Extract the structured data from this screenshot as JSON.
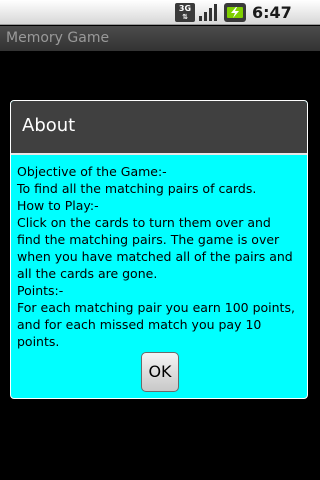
{
  "status_bar": {
    "network_label": "3G",
    "time": "6:47 PM"
  },
  "app": {
    "title": "Memory Game"
  },
  "dialog": {
    "title": "About",
    "lines": [
      "Objective of the Game:-",
      "To find all the matching pairs of cards.",
      "How to Play:-",
      "Click on the cards to turn them over and",
      "find the matching pairs. The game is over",
      "when you have matched all of the pairs and",
      "all the cards are gone.",
      "Points:-",
      "For each matching pair you earn 100 points,",
      "and for each missed match you pay 10",
      "points."
    ],
    "ok_label": "OK",
    "body_color": "#00ffff",
    "header_color": "#404040"
  }
}
